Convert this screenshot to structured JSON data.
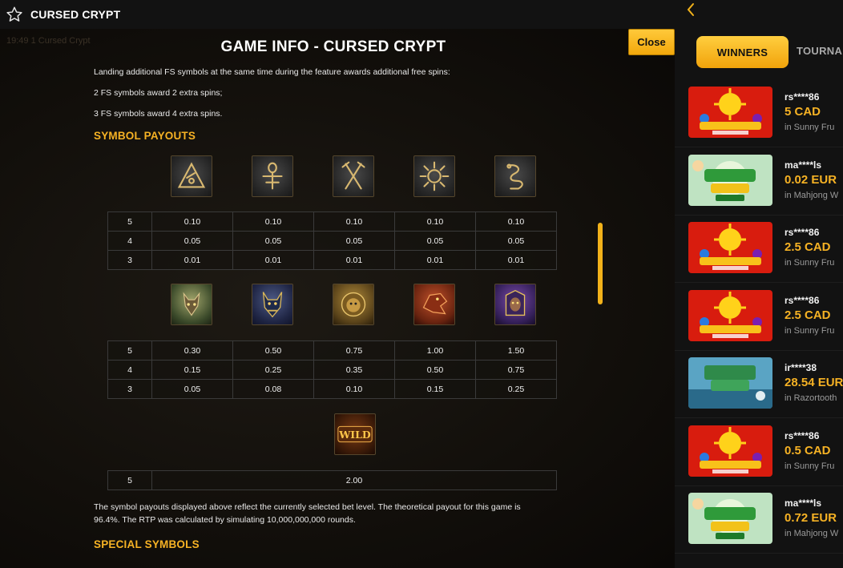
{
  "header": {
    "title": "CURSED CRYPT",
    "favorite_icon": "star-icon"
  },
  "background": {
    "ghost_text": "19:49 1 Cursed Crypt"
  },
  "panel": {
    "title": "GAME INFO - CURSED CRYPT",
    "close_label": "Close",
    "intro_lines": [
      "Landing additional FS symbols at the same time during the feature awards additional free spins:",
      "2 FS symbols award 2 extra spins;",
      "3 FS symbols award 4 extra spins."
    ],
    "symbol_payouts_heading": "SYMBOL PAYOUTS",
    "low_symbols": {
      "icons": [
        "triangle-glyph-icon",
        "ankh-glyph-icon",
        "crossed-tools-glyph-icon",
        "sun-glyph-icon",
        "serpent-glyph-icon"
      ],
      "rows": [
        {
          "count": "5",
          "values": [
            "0.10",
            "0.10",
            "0.10",
            "0.10",
            "0.10"
          ]
        },
        {
          "count": "4",
          "values": [
            "0.05",
            "0.05",
            "0.05",
            "0.05",
            "0.05"
          ]
        },
        {
          "count": "3",
          "values": [
            "0.01",
            "0.01",
            "0.01",
            "0.01",
            "0.01"
          ]
        }
      ]
    },
    "high_symbols": {
      "icons": [
        "jackal-warrior-icon",
        "anubis-icon",
        "lion-icon",
        "dragon-icon",
        "pharaoh-icon"
      ],
      "rows": [
        {
          "count": "5",
          "values": [
            "0.30",
            "0.50",
            "0.75",
            "1.00",
            "1.50"
          ]
        },
        {
          "count": "4",
          "values": [
            "0.15",
            "0.25",
            "0.35",
            "0.50",
            "0.75"
          ]
        },
        {
          "count": "3",
          "values": [
            "0.05",
            "0.08",
            "0.10",
            "0.15",
            "0.25"
          ]
        }
      ]
    },
    "wild": {
      "icon": "wild-symbol-icon",
      "label": "WILD",
      "count": "5",
      "value": "2.00"
    },
    "footer_lines": [
      "The symbol payouts displayed above reflect the currently selected bet level. The theoretical payout for this game is",
      "96.4%. The RTP was calculated by simulating 10,000,000,000 rounds."
    ],
    "special_symbols_heading": "SPECIAL SYMBOLS"
  },
  "sidebar": {
    "back_icon": "chevron-left-icon",
    "tabs": [
      {
        "label": "WINNERS",
        "active": true
      },
      {
        "label": "TOURNA",
        "active": false
      }
    ],
    "winners": [
      {
        "user": "rs****86",
        "amount": "5 CAD",
        "game": "in Sunny Fru",
        "thumb": "sunny"
      },
      {
        "user": "ma****ls",
        "amount": "0.02 EUR",
        "game": "in Mahjong W",
        "thumb": "mahjong"
      },
      {
        "user": "rs****86",
        "amount": "2.5 CAD",
        "game": "in Sunny Fru",
        "thumb": "sunny"
      },
      {
        "user": "rs****86",
        "amount": "2.5 CAD",
        "game": "in Sunny Fru",
        "thumb": "sunny"
      },
      {
        "user": "ir****38",
        "amount": "28.54 EUR",
        "game": "in Razortooth",
        "thumb": "razor"
      },
      {
        "user": "rs****86",
        "amount": "0.5 CAD",
        "game": "in Sunny Fru",
        "thumb": "sunny"
      },
      {
        "user": "ma****ls",
        "amount": "0.72 EUR",
        "game": "in Mahjong W",
        "thumb": "mahjong"
      }
    ]
  },
  "colors": {
    "accent": "#f6b224",
    "panel_bg": "#121212"
  }
}
